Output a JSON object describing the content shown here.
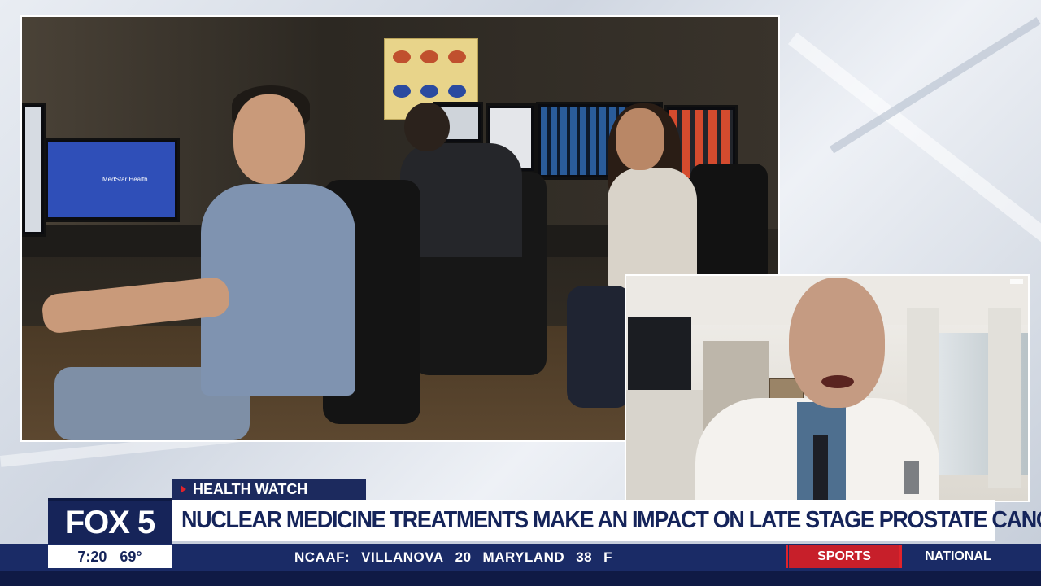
{
  "segment_tag": "HEALTH WATCH",
  "network_logo": "FOX 5",
  "headline": "NUCLEAR MEDICINE TREATMENTS MAKE AN IMPACT ON LATE STAGE PROSTATE CANCER",
  "clock": {
    "time": "7:20",
    "temperature": "69°"
  },
  "ticker": {
    "league": "NCAAF:",
    "team1": "VILLANOVA",
    "score1": "20",
    "team2": "MARYLAND",
    "score2": "38",
    "status": "F",
    "category_active": "SPORTS",
    "category_next": "NATIONAL"
  },
  "main_video": {
    "monitor_text": "MedStar Health"
  },
  "colors": {
    "navy": "#15245a",
    "red": "#e0232b",
    "white": "#ffffff"
  }
}
